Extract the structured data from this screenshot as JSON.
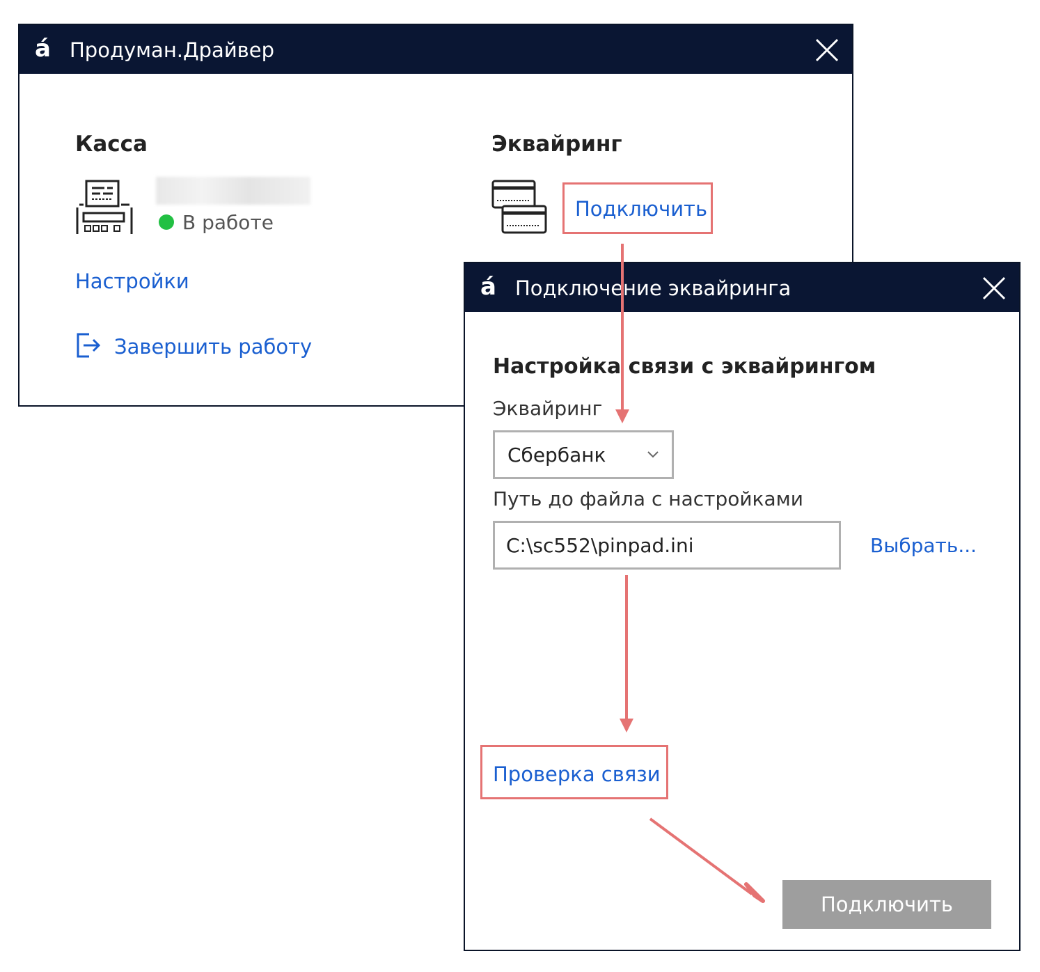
{
  "main_window": {
    "title": "Продуман.Драйвер",
    "logo": "á",
    "kassa": {
      "heading": "Касса",
      "status": "В работе",
      "status_color": "#22c043"
    },
    "acquiring": {
      "heading": "Эквайринг",
      "connect_link": "Подключить"
    },
    "settings_link": "Настройки",
    "finish_link": "Завершить работу"
  },
  "dialog": {
    "title": "Подключение эквайринга",
    "logo": "á",
    "heading": "Настройка связи с эквайрингом",
    "acquiring_label": "Эквайринг",
    "acquiring_value": "Сбербанк",
    "path_label": "Путь до файла с настройками",
    "path_value": "C:\\sc552\\pinpad.ini",
    "browse_link": "Выбрать...",
    "check_link": "Проверка связи",
    "connect_button": "Подключить"
  },
  "colors": {
    "titlebar": "#0a1633",
    "link": "#1a5fd0",
    "highlight": "#e57373",
    "button_disabled": "#9e9e9e"
  }
}
